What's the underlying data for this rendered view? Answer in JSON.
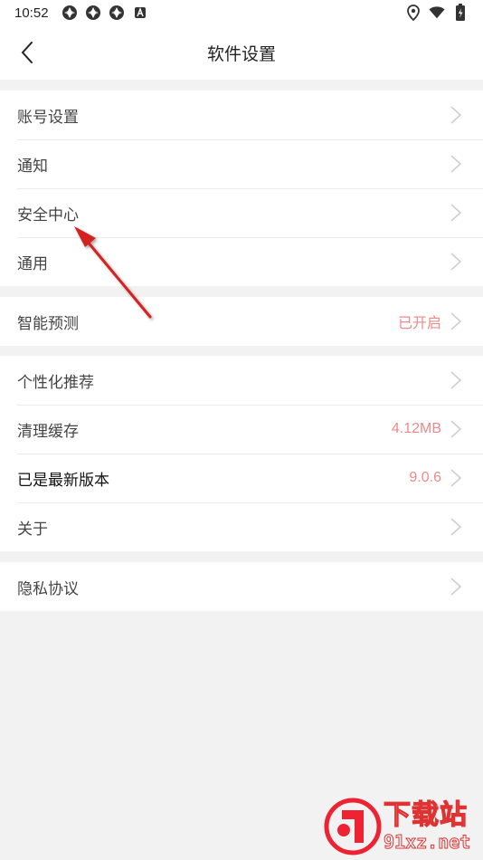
{
  "status_bar": {
    "time": "10:52",
    "left_icons": [
      "app-icon",
      "app-icon",
      "app-icon",
      "accessibility-icon"
    ],
    "right_icons": [
      "location-icon",
      "wifi-icon",
      "battery-icon"
    ]
  },
  "header": {
    "title": "软件设置"
  },
  "groups": [
    {
      "items": [
        {
          "label": "账号设置",
          "value": ""
        },
        {
          "label": "通知",
          "value": ""
        },
        {
          "label": "安全中心",
          "value": ""
        },
        {
          "label": "通用",
          "value": ""
        }
      ]
    },
    {
      "items": [
        {
          "label": "智能预测",
          "value": "已开启"
        }
      ]
    },
    {
      "items": [
        {
          "label": "个性化推荐",
          "value": ""
        },
        {
          "label": "清理缓存",
          "value": "4.12MB"
        },
        {
          "label": "已是最新版本",
          "value": "9.0.6"
        },
        {
          "label": "关于",
          "value": ""
        }
      ]
    },
    {
      "items": [
        {
          "label": "隐私协议",
          "value": ""
        }
      ]
    }
  ],
  "colors": {
    "value_accent": "#ef8a8a",
    "background": "#f2f2f2",
    "annotation_arrow": "#d42020"
  },
  "watermark": {
    "cn": "下载站",
    "url": "91xz.net"
  }
}
